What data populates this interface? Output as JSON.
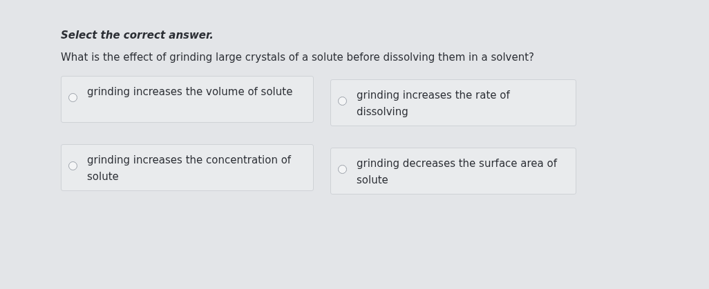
{
  "instruction": "Select the correct answer.",
  "question": "What is the effect of grinding large crystals of a solute before dissolving them in a solvent?",
  "options": [
    {
      "text": "grinding increases the volume of solute",
      "selected": false
    },
    {
      "text": "grinding increases the rate of dissolving",
      "selected": false
    },
    {
      "text": "grinding increases the concentration of solute",
      "selected": false
    },
    {
      "text": "grinding decreases the surface area of solute",
      "selected": false
    }
  ]
}
